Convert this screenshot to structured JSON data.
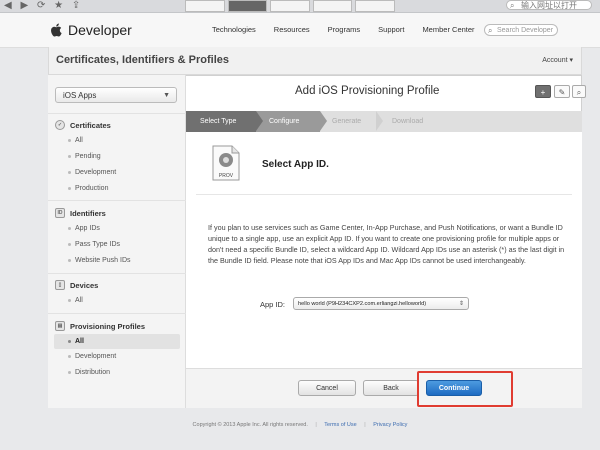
{
  "browser": {
    "nav_glyphs": "◀ ▶ ⟳ ★ ⇪",
    "search_placeholder": "输入网址以打开",
    "search_icon": "search-icon"
  },
  "topnav": {
    "brand": "Developer",
    "links": [
      "Technologies",
      "Resources",
      "Programs",
      "Support",
      "Member Center"
    ],
    "search_placeholder": "Search Developer"
  },
  "header": {
    "title": "Certificates, Identifiers & Profiles",
    "account": "Account ▾"
  },
  "sidebar": {
    "platform": "iOS Apps",
    "sections": [
      {
        "title": "Certificates",
        "items": [
          "All",
          "Pending",
          "Development",
          "Production"
        ]
      },
      {
        "title": "Identifiers",
        "items": [
          "App IDs",
          "Pass Type IDs",
          "Website Push IDs"
        ]
      },
      {
        "title": "Devices",
        "items": [
          "All"
        ]
      },
      {
        "title": "Provisioning Profiles",
        "items": [
          "All",
          "Development",
          "Distribution"
        ]
      }
    ]
  },
  "main": {
    "title": "Add iOS Provisioning Profile",
    "tools": {
      "add": "+",
      "edit": "✎",
      "search": "⌕"
    },
    "steps": [
      "Select Type",
      "Configure",
      "Generate",
      "Download"
    ],
    "doc_icon_label": "PROV",
    "heading": "Select App ID.",
    "description": "If you plan to use services such as Game Center, In-App Purchase, and Push Notifications, or want a Bundle ID unique to a single app, use an explicit App ID. If you want to create one provisioning profile for multiple apps or don't need a specific Bundle ID, select a wildcard App ID. Wildcard App IDs use an asterisk (*) as the last digit in the Bundle ID field. Please note that iOS App IDs and Mac App IDs cannot be used interchangeably.",
    "app_id_label": "App ID:",
    "app_id_value": "hello world (P9H234CXP2.com.erliangzi.helloworld)",
    "buttons": {
      "cancel": "Cancel",
      "back": "Back",
      "continue": "Continue"
    }
  },
  "footer": {
    "copyright": "Copyright © 2013 Apple Inc. All rights reserved.",
    "terms": "Terms of Use",
    "privacy": "Privacy Policy"
  },
  "colors": {
    "accent": "#1e6bc2",
    "highlight": "#e03c31"
  }
}
